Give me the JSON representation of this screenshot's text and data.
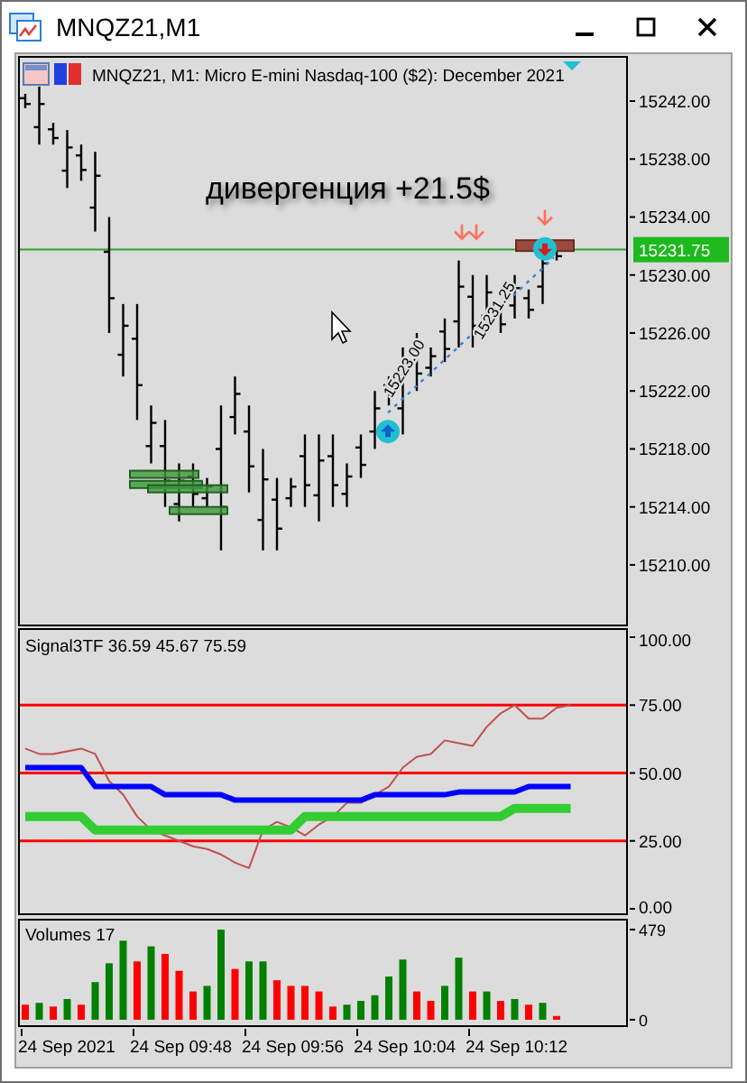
{
  "window": {
    "title": "MNQZ21,M1"
  },
  "price_pane": {
    "header": "MNQZ21, M1:  Micro E-mini Nasdaq-100 ($2): December 2021",
    "annotation": "дивергенция +21.5$",
    "axis_labels": [
      "15242.00",
      "15238.00",
      "15234.00",
      "15230.00",
      "15226.00",
      "15222.00",
      "15218.00",
      "15214.00",
      "15210.00"
    ],
    "current_price": "15231.75",
    "trend_labels": [
      "15223.00",
      "15231.25"
    ]
  },
  "indicator_pane": {
    "label": "Signal3TF 36.59 45.67 75.59",
    "chart_data": {
      "type": "line",
      "ylim": [
        -2,
        103
      ],
      "grid": true,
      "yticks": [
        {
          "value": 0,
          "label": "0.00"
        },
        {
          "value": 25,
          "label": "25.00"
        },
        {
          "value": 50,
          "label": "50.00"
        },
        {
          "value": 75,
          "label": "75.00"
        },
        {
          "value": 100,
          "label": "100.00"
        }
      ],
      "series": [
        {
          "color": "#c05050",
          "values": [
            59,
            57,
            57,
            58,
            59,
            57,
            47,
            42,
            34,
            29,
            27,
            25,
            23,
            22,
            20,
            17,
            15,
            29,
            32,
            30,
            27,
            31,
            34,
            39,
            39,
            42,
            45,
            52,
            56,
            57,
            62,
            61,
            60,
            67,
            72,
            75,
            70,
            70,
            74,
            75
          ]
        },
        {
          "color": "#0000ff",
          "values": [
            52,
            52,
            52,
            52,
            52,
            45,
            45,
            45,
            45,
            45,
            42,
            42,
            42,
            42,
            42,
            40,
            40,
            40,
            40,
            40,
            40,
            40,
            40,
            40,
            40,
            42,
            42,
            42,
            42,
            42,
            42,
            43,
            43,
            43,
            43,
            43,
            45,
            45,
            45,
            45
          ]
        },
        {
          "color": "#32cd32",
          "values": [
            34,
            34,
            34,
            34,
            34,
            29,
            29,
            29,
            29,
            29,
            29,
            29,
            29,
            29,
            29,
            29,
            29,
            29,
            29,
            29,
            34,
            34,
            34,
            34,
            34,
            34,
            34,
            34,
            34,
            34,
            34,
            34,
            34,
            34,
            34,
            37,
            37,
            37,
            37,
            37
          ]
        }
      ]
    }
  },
  "volume_pane": {
    "label": "Volumes 17",
    "chart_data": {
      "type": "bar",
      "stacked": true,
      "ylim": [
        -34,
        532
      ],
      "yticks": [
        0,
        479
      ],
      "series": [
        {
          "color": "#008000",
          "values": [
            null,
            90,
            null,
            110,
            null,
            200,
            300,
            420,
            null,
            390,
            null,
            null,
            null,
            180,
            479,
            null,
            310,
            310,
            null,
            null,
            null,
            null,
            null,
            80,
            100,
            130,
            230,
            320,
            null,
            null,
            180,
            330,
            null,
            150,
            null,
            110,
            null,
            90,
            null
          ]
        },
        {
          "color": "#ff0000",
          "values": [
            80,
            null,
            70,
            null,
            80,
            null,
            null,
            null,
            310,
            null,
            350,
            260,
            150,
            null,
            null,
            270,
            null,
            null,
            210,
            180,
            180,
            150,
            70,
            null,
            null,
            null,
            null,
            null,
            150,
            100,
            null,
            null,
            150,
            null,
            100,
            null,
            80,
            null,
            20
          ]
        }
      ]
    }
  },
  "time_axis": [
    "24 Sep 2021",
    "24 Sep 09:48",
    "24 Sep 09:56",
    "24 Sep 10:04",
    "24 Sep 10:12"
  ]
}
